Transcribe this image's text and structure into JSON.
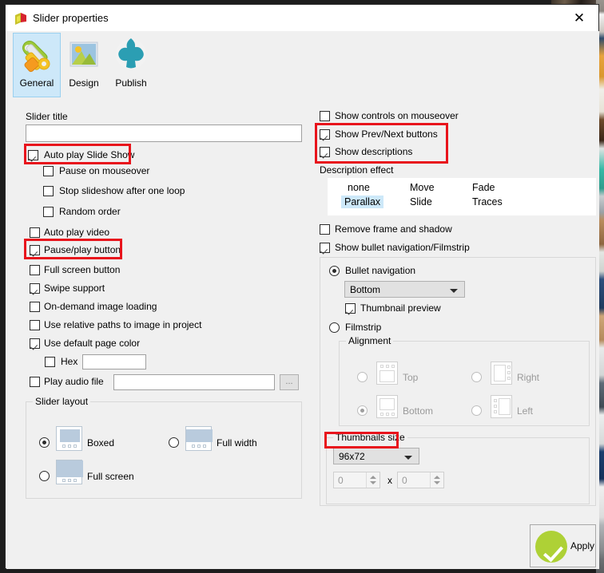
{
  "window": {
    "title": "Slider properties",
    "app_icon": "app-logo-icon",
    "close_label": "✕"
  },
  "tabs": [
    {
      "label": "General",
      "icon": "wrench-screwdriver-icon",
      "selected": true
    },
    {
      "label": "Design",
      "icon": "picture-icon",
      "selected": false
    },
    {
      "label": "Publish",
      "icon": "upload-cloud-icon",
      "selected": false
    }
  ],
  "left": {
    "slider_title_label": "Slider title",
    "slider_title_value": "",
    "slider_title_placeholder": "",
    "checks": [
      {
        "label": "Auto play Slide Show",
        "checked": true
      },
      {
        "label": "Pause on mouseover",
        "checked": false
      },
      {
        "label": "Stop slideshow after one loop",
        "checked": false
      },
      {
        "label": "Random order",
        "checked": false
      },
      {
        "label": "Auto play video",
        "checked": false
      },
      {
        "label": "Pause/play button",
        "checked": true
      },
      {
        "label": "Full screen button",
        "checked": false
      },
      {
        "label": "Swipe support",
        "checked": true
      },
      {
        "label": "On-demand image loading",
        "checked": false
      },
      {
        "label": "Use relative paths to image in project",
        "checked": false
      },
      {
        "label": "Use default page color",
        "checked": true
      },
      {
        "label": "Hex",
        "checked": false
      },
      {
        "label": "Play audio file",
        "checked": false
      }
    ],
    "hex_value": "",
    "audio_value": "",
    "browse_label": "...",
    "layout_group": "Slider layout",
    "layout_options": [
      {
        "label": "Boxed",
        "selected": true
      },
      {
        "label": "Full width",
        "selected": false
      },
      {
        "label": "Full screen",
        "selected": false
      }
    ]
  },
  "right": {
    "checks": [
      {
        "label": "Show controls on mouseover",
        "checked": false
      },
      {
        "label": "Show Prev/Next buttons",
        "checked": true
      },
      {
        "label": "Show descriptions",
        "checked": true
      },
      {
        "label": "Remove frame and shadow",
        "checked": false
      },
      {
        "label": "Show bullet navigation/Filmstrip",
        "checked": true
      }
    ],
    "description_effect_label": "Description effect",
    "description_effects": [
      {
        "label": "none",
        "selected": false
      },
      {
        "label": "Parallax",
        "selected": true
      },
      {
        "label": "Move",
        "selected": false
      },
      {
        "label": "Slide",
        "selected": false
      },
      {
        "label": "Fade",
        "selected": false
      },
      {
        "label": "Traces",
        "selected": false
      }
    ],
    "nav_options": [
      {
        "label": "Bullet navigation",
        "selected": true
      },
      {
        "label": "Filmstrip",
        "selected": false
      }
    ],
    "position_value": "Bottom",
    "thumbnail_preview_label": "Thumbnail preview",
    "thumbnail_preview_checked": true,
    "alignment_group": "Alignment",
    "alignment_options": [
      {
        "label": "Top",
        "selected": false
      },
      {
        "label": "Right",
        "selected": false
      },
      {
        "label": "Bottom",
        "selected": true
      },
      {
        "label": "Left",
        "selected": false
      }
    ],
    "thumbnails_size_group": "Thumbnails size",
    "thumbnails_size_value": "96x72",
    "thumb_width": "0",
    "thumb_height": "0",
    "thumb_sep": "x"
  },
  "apply": {
    "label": "Apply",
    "icon": "green-check-icon",
    "color": "#aed136"
  },
  "highlights": {
    "accent_color": "#e8141c"
  }
}
